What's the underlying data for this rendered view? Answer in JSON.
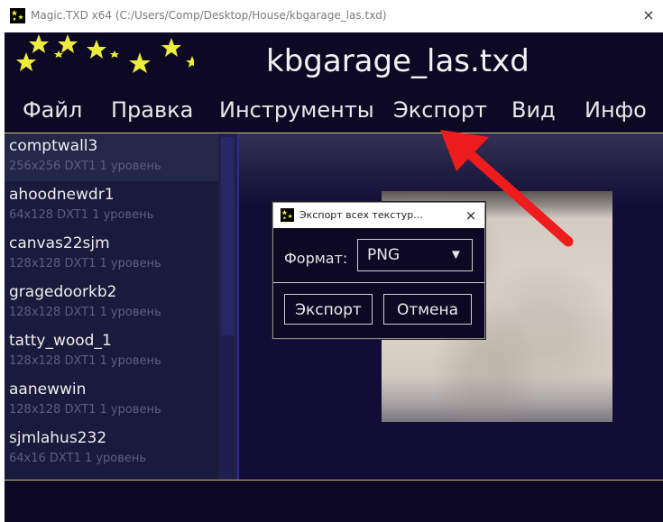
{
  "window": {
    "title": "Magic.TXD x64 (C:/Users/Comp/Desktop/House/kbgarage_las.txd)",
    "close_glyph": "×",
    "icon": "magic-txd-stars-icon"
  },
  "app": {
    "file_title": "kbgarage_las.txd",
    "menu": [
      {
        "label": "Файл"
      },
      {
        "label": "Правка"
      },
      {
        "label": "Инструменты"
      },
      {
        "label": "Экспорт"
      },
      {
        "label": "Вид"
      },
      {
        "label": "Инфо"
      }
    ]
  },
  "textures": [
    {
      "name": "comptwall3",
      "info": "256x256 DXT1 1 уровень",
      "selected": true
    },
    {
      "name": "ahoodnewdr1",
      "info": "64x128 DXT1 1 уровень"
    },
    {
      "name": "canvas22sjm",
      "info": "128x128 DXT1 1 уровень"
    },
    {
      "name": "gragedoorkb2",
      "info": "128x128 DXT1 1 уровень"
    },
    {
      "name": "tatty_wood_1",
      "info": "128x128 DXT1 1 уровень"
    },
    {
      "name": "aanewwin",
      "info": "128x128 DXT1 1 уровень"
    },
    {
      "name": "sjmlahus232",
      "info": "64x16 DXT1 1 уровень"
    }
  ],
  "dialog": {
    "title": "Экспорт всех текстур...",
    "close_glyph": "×",
    "format_label": "Формат:",
    "format_value": "PNG",
    "arrow_glyph": "▼",
    "export_label": "Экспорт",
    "cancel_label": "Отмена"
  },
  "colors": {
    "app_bg": "#0d0924",
    "accent_line": "#c9bf73",
    "star": "#ecec3a",
    "annotation_arrow": "#ee1c1c"
  }
}
